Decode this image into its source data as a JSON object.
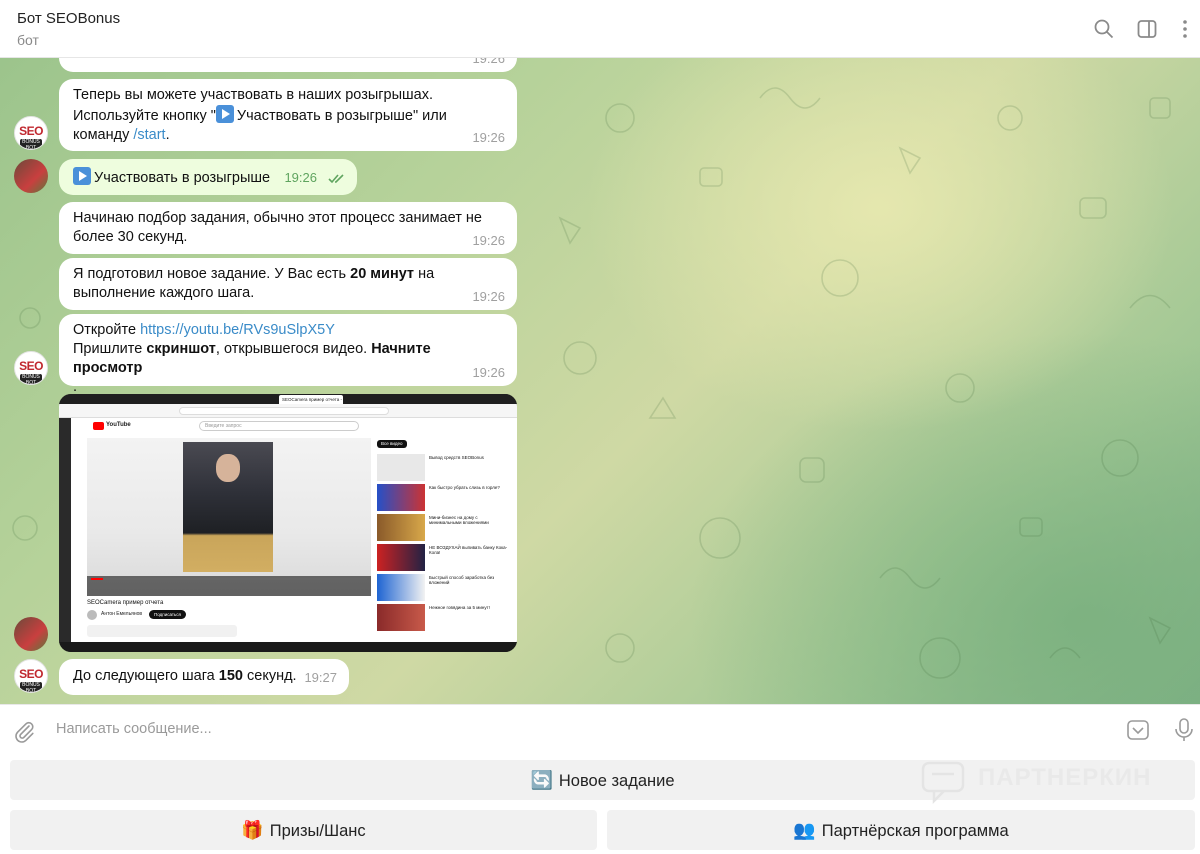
{
  "header": {
    "title": "Бот SEOBonus",
    "subtitle": "бот"
  },
  "messages": {
    "m0": {
      "time": "19:26"
    },
    "m1": {
      "line1": "Теперь вы можете участвовать в наших розыгрышах.",
      "line2": "Используйте кнопку \"",
      "btn": "Участвовать в розыгрыше",
      "line2b": "\" или",
      "line3a": "команду ",
      "cmd": "/start",
      "line3b": ".",
      "time": "19:26"
    },
    "m2": {
      "text": "Участвовать в розыгрыше",
      "time": "19:26"
    },
    "m3": {
      "text1": "Начинаю подбор задания, обычно этот процесс занимает не",
      "text2": "более 30 секунд.",
      "time": "19:26"
    },
    "m4": {
      "a": "Я подготовил новое задание. У Вас есть ",
      "bold": "20 минут",
      "b": " на",
      "c": "выполнение каждого шага.",
      "time": "19:26"
    },
    "m5": {
      "a": "Откройте ",
      "link": "https://youtu.be/RVs9uSlpX5Y",
      "b": "Пришлите ",
      "bold1": "скриншот",
      "c": ", открывшегося видео.  ",
      "bold2": "Начните просмотр",
      "d": ".",
      "time": "19:26"
    },
    "m6": {
      "a": "До следующего шага ",
      "bold": "150",
      "b": " секунд.",
      "time": "19:27"
    }
  },
  "screenshot": {
    "tab_title": "SEOCamera пример отчета - YouTube",
    "search_ph": "Введите запрос",
    "video_title": "SEOCamera пример отчета",
    "channel": "Антон Емельянов",
    "subscribe": "Подписаться",
    "chip_all": "Все видео",
    "side_items": [
      "Вывод средств SEOBonus",
      "Как быстро убрать слизь в горле?",
      "Мини-бизнес на дому с минимальными вложениями",
      "НЕ ВОЗДУХАЙ выпивать банку Кока-Кола!",
      "Быстрый способ заработка без вложений",
      "Нежное говядина за 5 минут!"
    ]
  },
  "composer": {
    "placeholder": "Написать сообщение..."
  },
  "keyboard": {
    "new_task": {
      "emoji": "🔄",
      "label": "Новое задание"
    },
    "prizes": {
      "emoji": "🎁",
      "label": "Призы/Шанс"
    },
    "partner": {
      "emoji": "👥",
      "label": "Партнёрская программа"
    }
  },
  "watermark": "ПАРТНЕРКИН",
  "avatars": {
    "seo_line1": "SEO",
    "seo_line2": "BONUS BOT"
  }
}
